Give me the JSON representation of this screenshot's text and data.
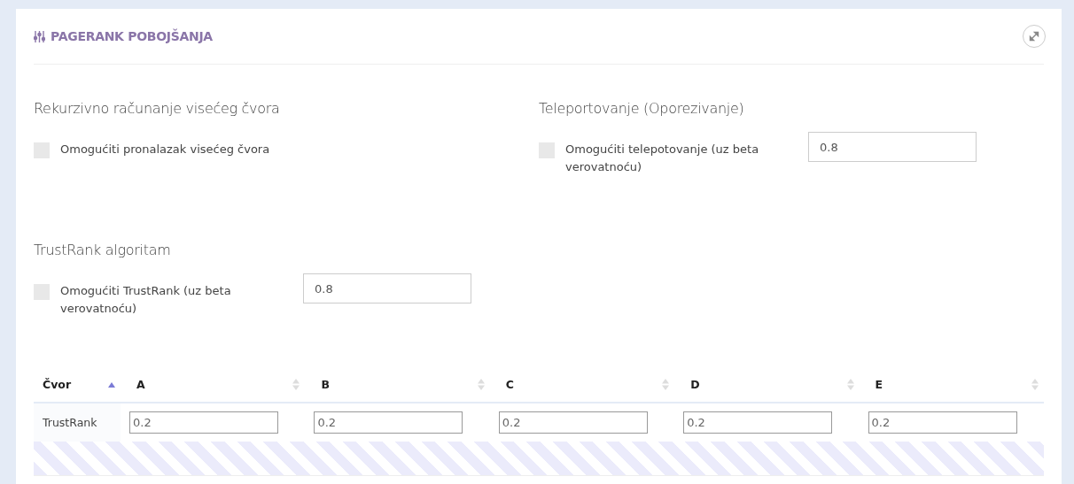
{
  "panel": {
    "title": "PAGERANK POBOJŠANJA"
  },
  "sections": [
    {
      "title": "Rekurzivno računanje visećeg čvora",
      "option": {
        "label": "Omogućiti pronalazak visećeg čvora",
        "checked": false
      }
    },
    {
      "title": "Teleportovanje (Oporezivanje)",
      "option": {
        "label": "Omogućiti telepotovanje (uz beta verovatnoću)",
        "checked": false,
        "value": "0.8"
      }
    },
    {
      "title": "TrustRank algoritam",
      "option": {
        "label": "Omogućiti TrustRank (uz beta verovatnoću)",
        "checked": false,
        "value": "0.8"
      }
    }
  ],
  "table": {
    "columns": [
      {
        "label": "Čvor",
        "sorted": true
      },
      {
        "label": "A",
        "sorted": false
      },
      {
        "label": "B",
        "sorted": false
      },
      {
        "label": "C",
        "sorted": false
      },
      {
        "label": "D",
        "sorted": false
      },
      {
        "label": "E",
        "sorted": false
      }
    ],
    "rows": [
      {
        "label": "TrustRank",
        "values": [
          "0.2",
          "0.2",
          "0.2",
          "0.2",
          "0.2"
        ]
      }
    ]
  }
}
